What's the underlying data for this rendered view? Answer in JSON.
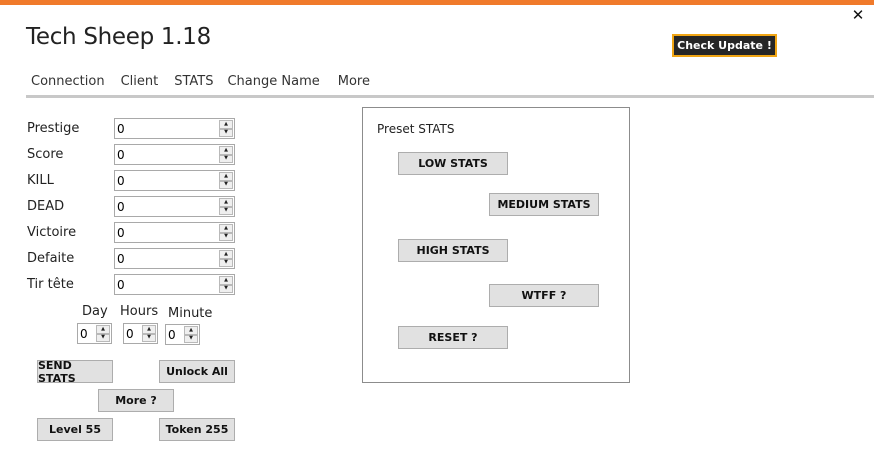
{
  "window": {
    "title": "Tech Sheep 1.18",
    "close_icon": "close-icon",
    "accent_color": "#f07a2b",
    "update_border_color": "#f0a514"
  },
  "header": {
    "check_update_label": "Check Update !"
  },
  "tabs": [
    {
      "label": "Connection",
      "active": false
    },
    {
      "label": "Client",
      "active": false
    },
    {
      "label": "STATS",
      "active": true
    },
    {
      "label": "Change Name",
      "active": false
    },
    {
      "label": "More",
      "active": false
    }
  ],
  "stats": [
    {
      "label": "Prestige",
      "value": "0"
    },
    {
      "label": "Score",
      "value": "0"
    },
    {
      "label": "KILL",
      "value": "0"
    },
    {
      "label": "DEAD",
      "value": "0"
    },
    {
      "label": "Victoire",
      "value": "0"
    },
    {
      "label": "Defaite",
      "value": "0"
    },
    {
      "label": "Tir tête",
      "value": "0"
    }
  ],
  "time": {
    "day_label": "Day",
    "day_value": "0",
    "hours_label": "Hours",
    "hours_value": "0",
    "minute_label": "Minute",
    "minute_value": "0"
  },
  "actions": {
    "send_stats": "SEND STATS",
    "unlock_all": "Unlock All",
    "more": "More ?",
    "level": "Level 55",
    "token": "Token 255"
  },
  "preset": {
    "title": "Preset STATS",
    "low": "LOW STATS",
    "medium": "MEDIUM STATS",
    "high": "HIGH STATS",
    "wtff": "WTFF ?",
    "reset": "RESET ?"
  }
}
